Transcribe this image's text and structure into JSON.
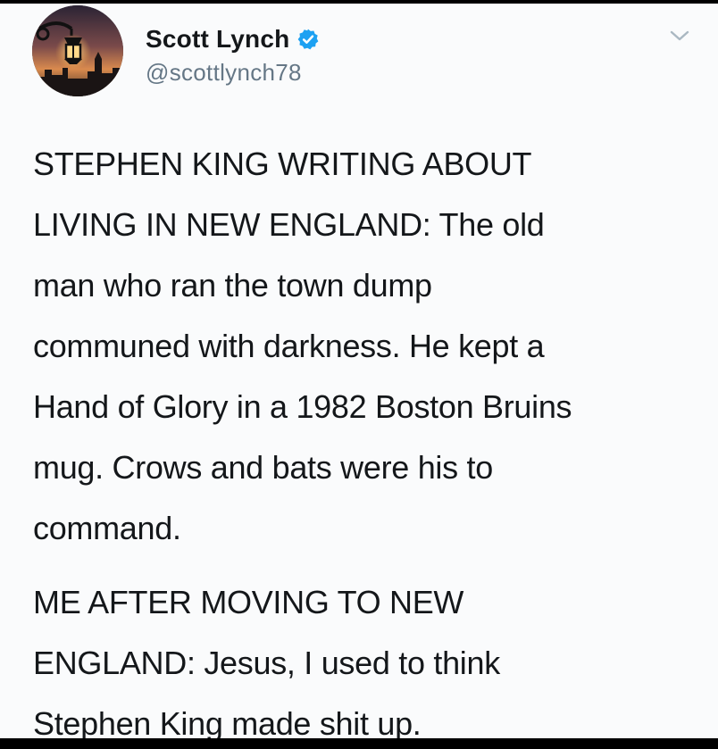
{
  "tweet": {
    "author": {
      "display_name": "Scott Lynch",
      "handle": "@scottlynch78",
      "verified": true,
      "avatar_icon": "lamppost-sunset-avatar",
      "verified_icon": "verified-badge-icon",
      "verified_color": "#1da1f2"
    },
    "menu_icon": "chevron-down-icon",
    "paragraphs": [
      "STEPHEN KING WRITING ABOUT\nLIVING IN NEW ENGLAND: The old\nman who ran the town dump\ncommuned with darkness. He kept a\nHand of Glory in a 1982 Boston Bruins\nmug. Crows and bats were his to\ncommand.",
      "ME AFTER MOVING TO NEW\nENGLAND: Jesus, I used to think\nStephen King made shit up."
    ]
  },
  "colors": {
    "card_background": "#fafbfc",
    "text_primary": "#14171a",
    "text_secondary": "#657786",
    "frame": "#000000"
  }
}
